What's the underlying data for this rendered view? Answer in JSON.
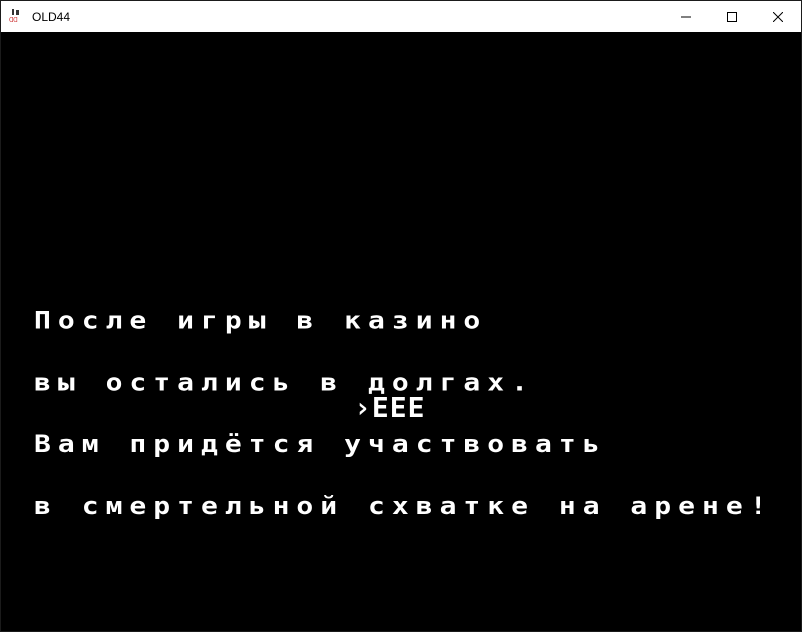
{
  "window": {
    "title": "OLD44",
    "icon": "game-app-icon",
    "controls": [
      "minimize-icon",
      "maximize-icon",
      "close-icon"
    ]
  },
  "game": {
    "background": "#000000",
    "text_color": "#ffffff",
    "story_lines": [
      "После игры в казино",
      "вы остались в долгах.",
      "Вам придётся участвовать",
      "в смертельной схватке на арене!"
    ],
    "choice": "›EEE"
  }
}
